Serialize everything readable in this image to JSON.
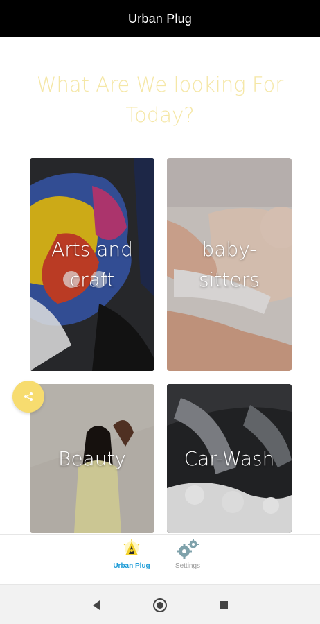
{
  "app": {
    "title": "Urban Plug"
  },
  "main": {
    "heading": "What Are We looking For Today?"
  },
  "categories": [
    {
      "label": "Arts and craft"
    },
    {
      "label": "baby-sitters"
    },
    {
      "label": "Beauty"
    },
    {
      "label": "Car-Wash"
    }
  ],
  "share_button": {
    "icon": "share-icon",
    "color": "#f7dc6f"
  },
  "bottom_nav": {
    "items": [
      {
        "label": "Urban Plug",
        "icon": "urban-plug-logo-icon",
        "active": true
      },
      {
        "label": "Settings",
        "icon": "gears-icon",
        "active": false
      }
    ]
  },
  "system_nav": {
    "buttons": [
      "back-icon",
      "home-icon",
      "recents-icon"
    ]
  },
  "colors": {
    "accent": "#f5e7a6",
    "fab": "#f7dc6f",
    "active_nav": "#1a9ad6",
    "app_bar": "#000000"
  }
}
